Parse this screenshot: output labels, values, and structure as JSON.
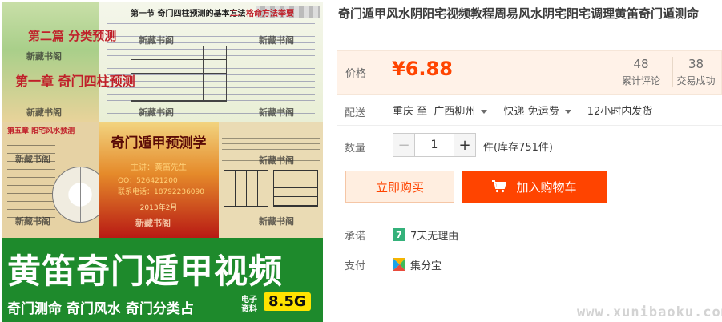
{
  "product_image": {
    "chapter_label_2": "第二篇 分类预测",
    "chapter_label_1": "第一章 奇门四柱预测",
    "section_heading": "第一节 奇门四柱预测的基本方法",
    "section_heading_2": "二、格命方法举要",
    "mid_left_heading": "第五章 阳宅风水预测",
    "watermark_text": "新藏书阁",
    "book_title": "奇门遁甲预测学",
    "book_author": "主讲：黄笛先生",
    "book_qq": "QQ：526421200",
    "book_phone": "联系电话：18792236090",
    "book_date": "2013年2月",
    "banner_title": "黄笛奇门遁甲视频",
    "banner_subtitle": "奇门测命 奇门风水 奇门分类占",
    "banner_badge_label": "电子资料",
    "banner_badge_value": "8.5G"
  },
  "product": {
    "title": "奇门遁甲风水阴阳宅视频教程周易风水阴宅阳宅调理黄笛奇门遁测命",
    "price_label": "价格",
    "price": "¥6.88",
    "reviews_count": "48",
    "reviews_label": "累计评论",
    "sales_count": "38",
    "sales_label": "交易成功"
  },
  "shipping": {
    "label": "配送",
    "origin": "重庆 至",
    "destination": "广西柳州",
    "method": "快递 免运费",
    "dispatch": "12小时内发货"
  },
  "quantity": {
    "label": "数量",
    "minus": "−",
    "value": "1",
    "plus": "+",
    "unit_stock": "件(库存751件)"
  },
  "actions": {
    "buy_now": "立即购买",
    "add_to_cart": "加入购物车"
  },
  "services": {
    "promise_label": "承诺",
    "promise_badge": "7",
    "promise_text": "7天无理由",
    "payment_label": "支付",
    "payment_text": "集分宝"
  },
  "site_watermark": "www.xunibaoku.com",
  "colors": {
    "accent": "#ff4400",
    "price_bg": "#fff2e8",
    "buy_bg": "#ffeee0",
    "banner_green": "#1e8a2c",
    "badge_yellow": "#ffe300",
    "promise_green": "#34b17a"
  }
}
